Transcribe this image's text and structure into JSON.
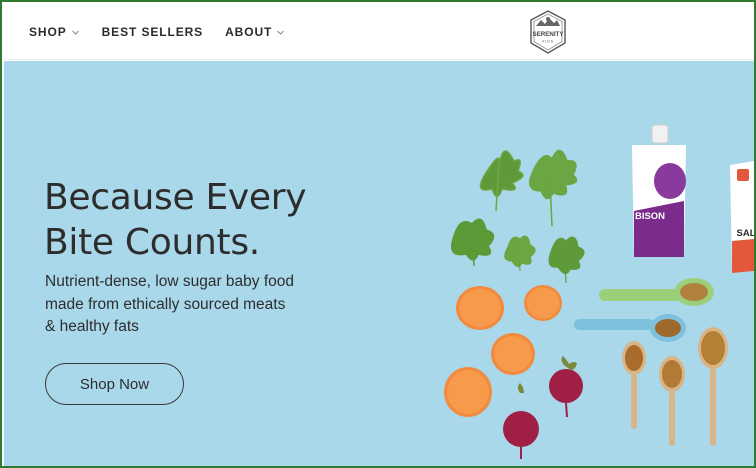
{
  "nav": {
    "items": [
      {
        "label": "SHOP",
        "has_dropdown": true
      },
      {
        "label": "BEST SELLERS",
        "has_dropdown": false
      },
      {
        "label": "ABOUT",
        "has_dropdown": true
      }
    ]
  },
  "logo": {
    "brand": "SERENITY",
    "tagline": "KIDS"
  },
  "hero": {
    "headline_line1": "Because Every",
    "headline_line2": "Bite Counts.",
    "subtext_line1": "Nutrient-dense, low sugar baby food",
    "subtext_line2": "made from ethically sourced meats",
    "subtext_line3": "& healthy fats",
    "cta_label": "Shop Now",
    "background_color": "#a9d8ea"
  },
  "products": {
    "pouch_1_name": "BISON",
    "pouch_2_name": "SAL"
  },
  "icons": [
    "chevron-down-icon",
    "serenity-kids-logo",
    "kale-leaf",
    "sweet-potato-slice",
    "beet",
    "spoon"
  ]
}
